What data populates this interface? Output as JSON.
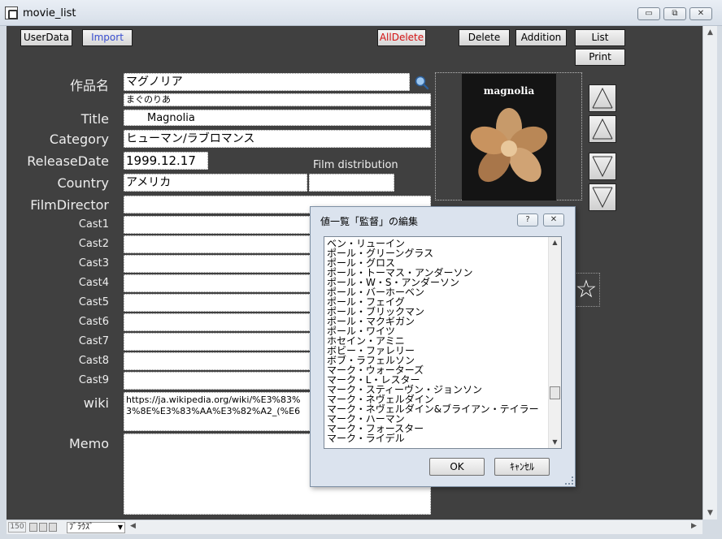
{
  "window": {
    "title": "movie_list",
    "minimize": "▭",
    "restore": "⧉",
    "close": "✕"
  },
  "toolbar": {
    "userdata": "UserData",
    "import": "Import",
    "alldelete": "AllDelete",
    "delete": "Delete",
    "addition": "Addition",
    "list": "List",
    "print": "Print"
  },
  "labels": {
    "title_jp": "作品名",
    "title": "Title",
    "category": "Category",
    "release_date": "ReleaseDate",
    "country": "Country",
    "film_director": "FilmDirector",
    "film_distribution": "Film distribution",
    "cast1": "Cast1",
    "cast2": "Cast2",
    "cast3": "Cast3",
    "cast4": "Cast4",
    "cast5": "Cast5",
    "cast6": "Cast6",
    "cast7": "Cast7",
    "cast8": "Cast8",
    "cast9": "Cast9",
    "wiki": "wiki",
    "memo": "Memo"
  },
  "fields": {
    "title_jp": "マグノリア",
    "reading": "まぐのりあ",
    "title": "Magnolia",
    "category": "ヒューマン/ラブロマンス",
    "release_date": "1999.12.17",
    "country": "アメリカ",
    "film_distribution": "",
    "film_director": "",
    "wiki_line1": "https://ja.wikipedia.org/wiki/%E3%83%",
    "wiki_line2": "3%8E%E3%83%AA%E3%82%A2_(%E6"
  },
  "poster": {
    "title": "magnolia"
  },
  "dialog": {
    "title": "値一覧「監督」の編集",
    "help": "?",
    "close": "✕",
    "items": [
      "ベン・リューイン",
      "ポール・グリーングラス",
      "ポール・グロス",
      "ポール・トーマス・アンダーソン",
      "ポール・W・S・アンダーソン",
      "ポール・バーホーベン",
      "ポール・フェイグ",
      "ポール・ブリックマン",
      "ポール・マクギガン",
      "ポール・ワイツ",
      "ホセイン・アミニ",
      "ボビー・ファレリー",
      "ボブ・ラフェルソン",
      "マーク・ウォーターズ",
      "マーク・L・レスター",
      "マーク・スティーヴン・ジョンソン",
      "マーク・ネヴェルダイン",
      "マーク・ネヴェルダイン&ブライアン・テイラー",
      "マーク・ハーマン",
      "マーク・フォースター",
      "マーク・ライデル"
    ],
    "ok": "OK",
    "cancel": "ｷｬﾝｾﾙ"
  },
  "statusbar": {
    "zoom": "150",
    "mode": "ﾌﾞﾗｳｽﾞ"
  },
  "icons": {
    "magnifier": "search-icon",
    "star": "star-icon"
  }
}
